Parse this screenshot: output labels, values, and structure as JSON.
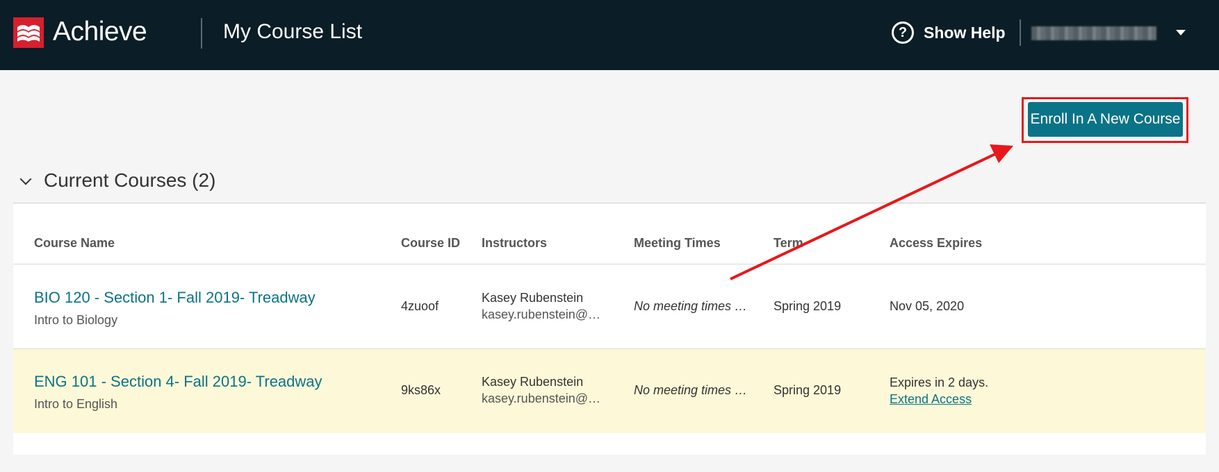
{
  "header": {
    "brand": "Achieve",
    "page_title": "My Course List",
    "help_label": "Show Help",
    "user_name": ""
  },
  "actions": {
    "enroll_label": "Enroll In A New Course"
  },
  "section": {
    "title": "Current Courses (2)"
  },
  "table": {
    "columns": [
      "Course Name",
      "Course ID",
      "Instructors",
      "Meeting Times",
      "Term",
      "Access Expires"
    ],
    "rows": [
      {
        "course_name": "BIO 120 - Section 1- Fall 2019- Treadway",
        "course_subtitle": "Intro to Biology",
        "course_id": "4zuoof",
        "instructor_name": "Kasey Rubenstein",
        "instructor_email": "kasey.rubenstein@…",
        "meeting_times": "No meeting times …",
        "term": "Spring 2019",
        "access_expires": "Nov 05, 2020",
        "access_action": ""
      },
      {
        "course_name": "ENG 101 - Section 4- Fall 2019- Treadway",
        "course_subtitle": "Intro to English",
        "course_id": "9ks86x",
        "instructor_name": "Kasey Rubenstein",
        "instructor_email": "kasey.rubenstein@…",
        "meeting_times": "No meeting times …",
        "term": "Spring 2019",
        "access_expires": "Expires in 2 days.",
        "access_action": "Extend Access"
      }
    ]
  },
  "colors": {
    "topbar": "#0b1d26",
    "brand_red": "#d6202f",
    "accent_teal": "#0b7387",
    "highlight_row": "#fdf9d8",
    "annotation_red": "#e8171b"
  }
}
